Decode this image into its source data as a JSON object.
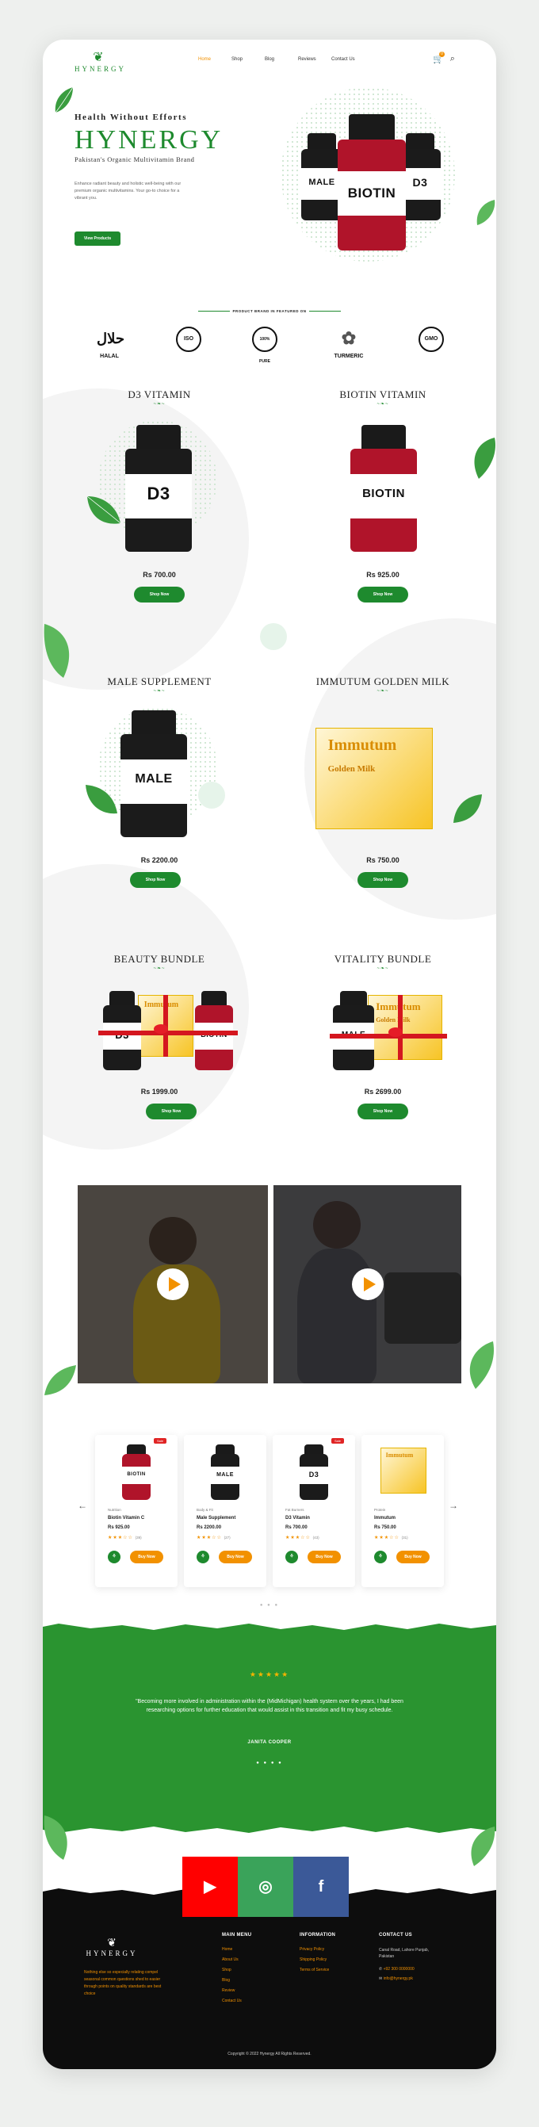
{
  "nav": {
    "brand": "HYNERGY",
    "menu": [
      "Home",
      "Shop",
      "Blog",
      "Reviews",
      "Contact Us"
    ],
    "cart_count": "0"
  },
  "hero": {
    "tagline": "Health Without Efforts",
    "title": "HYNERGY",
    "subtitle": "Pakistan's Organic Multivitamin Brand",
    "description": "Enhance radiant beauty and holistic well-being with our premium organic multivitamins. Your go-to choice for a vibrant you.",
    "button": "View Products",
    "bottle_labels": [
      "MALE",
      "BIOTIN",
      "D3"
    ]
  },
  "brands": {
    "title": "PRODUCT BRAND IN FEATURED ON",
    "badges": [
      {
        "icon": "حلال",
        "label": "HALAL"
      },
      {
        "icon": "ISO",
        "label": ""
      },
      {
        "icon": "100% PURE",
        "label": ""
      },
      {
        "icon": "✿",
        "label": "TURMERIC"
      },
      {
        "icon": "GMO",
        "label": ""
      }
    ]
  },
  "products": [
    {
      "name": "D3 VITAMIN",
      "label": "D3",
      "price": "Rs 700.00",
      "button": "Shop Now",
      "color": "#1b1b1b"
    },
    {
      "name": "BIOTIN VITAMIN",
      "label": "BIOTIN",
      "price": "Rs 925.00",
      "button": "Shop Now",
      "color": "#b0142a"
    },
    {
      "name": "MALE SUPPLEMENT",
      "label": "MALE",
      "price": "Rs 2200.00",
      "button": "Shop Now",
      "color": "#1b1b1b"
    },
    {
      "name": "IMMUTUM GOLDEN MILK",
      "label": "Immutum",
      "price": "Rs 750.00",
      "button": "Shop Now",
      "color": "#f2b600"
    },
    {
      "name": "BEAUTY BUNDLE",
      "label": "D3",
      "price": "Rs 1999.00",
      "button": "Shop Now",
      "color": "#1b1b1b"
    },
    {
      "name": "VITALITY BUNDLE",
      "label": "MALE",
      "price": "Rs 2699.00",
      "button": "Shop Now",
      "color": "#1b1b1b"
    }
  ],
  "box_label": "Immutum",
  "box_sub": "Golden Milk",
  "ornament": "~❧~",
  "carousel": [
    {
      "category": "Nutrition",
      "name": "Biotin Vitamin C",
      "price": "Rs 925.00",
      "stars": "★★★☆☆",
      "reviews": "(39)",
      "sale": "Sale",
      "button": "Buy Now",
      "label": "BIOTIN",
      "color": "#b0142a"
    },
    {
      "category": "Body & Fit",
      "name": "Male Supplement",
      "price": "Rs 2200.00",
      "stars": "★★★☆☆",
      "reviews": "(27)",
      "sale": "",
      "button": "Buy Now",
      "label": "MALE",
      "color": "#1b1b1b"
    },
    {
      "category": "Fat Burners",
      "name": "D3 Vitamin",
      "price": "Rs 700.00",
      "stars": "★★★☆☆",
      "reviews": "(43)",
      "sale": "Sale",
      "button": "Buy Now",
      "label": "D3",
      "color": "#1b1b1b"
    },
    {
      "category": "Protein",
      "name": "Immutum",
      "price": "Rs 750.00",
      "stars": "★★★☆☆",
      "reviews": "(31)",
      "sale": "",
      "button": "Buy Now",
      "label": "Immutum",
      "color": "#f2b600"
    }
  ],
  "carousel_dots": "● ● ●",
  "testimonial": {
    "stars": "★★★★★",
    "text": "\"Becoming more involved in administration within the (MidMichigan) health system over the years, I had been researching options for further education that would assist in this transition and fit my busy schedule.",
    "name": "JANITA COOPER",
    "dots": "● ● ● ●"
  },
  "social": [
    {
      "icon": "▶",
      "color": "#ff0000"
    },
    {
      "icon": "◎",
      "color": "#3aa35a"
    },
    {
      "icon": "f",
      "color": "#3b5998"
    }
  ],
  "footer": {
    "brand": "HYNERGY",
    "about": "Nothing else so especially relating compel seasonal common questions shed to easier through points on quality standards are best choice",
    "main_menu_title": "MAIN MENU",
    "main_menu": [
      "Home",
      "About Us",
      "Shop",
      "Blog",
      "Review",
      "Contact Us"
    ],
    "info_title": "INFORMATION",
    "info": [
      "Privacy Policy",
      "Shipping Policy",
      "Terms of Service"
    ],
    "contact_title": "CONTACT US",
    "address": "Canal Road, Lahore Punjab, Pakistan",
    "phone": "+92 300 0000000",
    "email": "info@hynergy.pk",
    "copyright": "Copyright © 2022 Hynergy All Rights Reserved."
  }
}
